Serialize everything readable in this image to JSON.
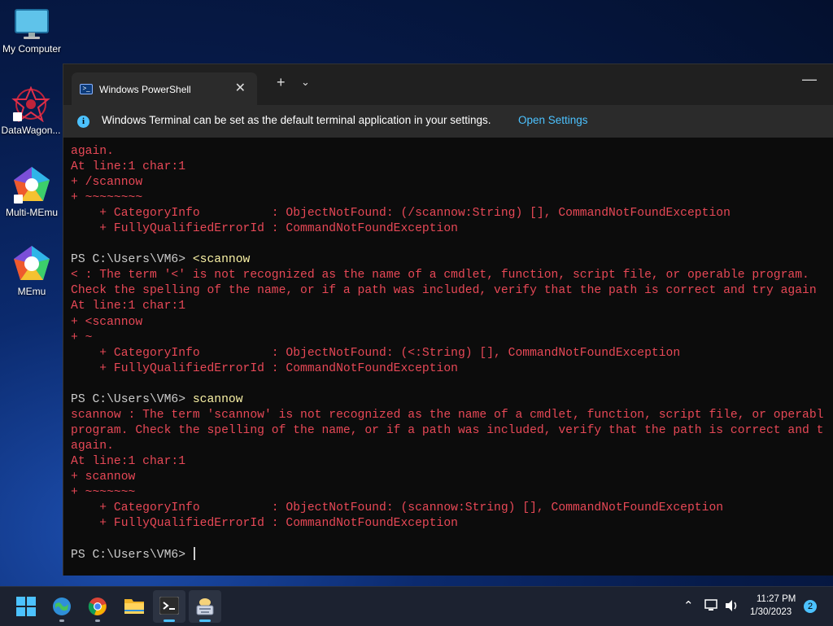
{
  "desktop": {
    "icons": [
      {
        "label": "My Computer"
      },
      {
        "label": "DataWagon..."
      },
      {
        "label": "Multi-MEmu"
      },
      {
        "label": "MEmu"
      }
    ]
  },
  "terminal": {
    "tab_title": "Windows PowerShell",
    "info_text": "Windows Terminal can be set as the default terminal application in your settings.",
    "info_link": "Open Settings",
    "lines": [
      {
        "type": "err",
        "text": "again."
      },
      {
        "type": "err",
        "text": "At line:1 char:1"
      },
      {
        "type": "err",
        "text": "+ /scannow"
      },
      {
        "type": "err",
        "text": "+ ~~~~~~~~"
      },
      {
        "type": "err",
        "text": "    + CategoryInfo          : ObjectNotFound: (/scannow:String) [], CommandNotFoundException"
      },
      {
        "type": "err",
        "text": "    + FullyQualifiedErrorId : CommandNotFoundException"
      },
      {
        "type": "blank",
        "text": ""
      },
      {
        "type": "cmd",
        "prompt": "PS C:\\Users\\VM6> ",
        "text": "<scannow"
      },
      {
        "type": "err",
        "text": "< : The term '<' is not recognized as the name of a cmdlet, function, script file, or operable program."
      },
      {
        "type": "err",
        "text": "Check the spelling of the name, or if a path was included, verify that the path is correct and try again"
      },
      {
        "type": "err",
        "text": "At line:1 char:1"
      },
      {
        "type": "err",
        "text": "+ <scannow"
      },
      {
        "type": "err",
        "text": "+ ~"
      },
      {
        "type": "err",
        "text": "    + CategoryInfo          : ObjectNotFound: (<:String) [], CommandNotFoundException"
      },
      {
        "type": "err",
        "text": "    + FullyQualifiedErrorId : CommandNotFoundException"
      },
      {
        "type": "blank",
        "text": ""
      },
      {
        "type": "cmd",
        "prompt": "PS C:\\Users\\VM6> ",
        "text": "scannow"
      },
      {
        "type": "err",
        "text": "scannow : The term 'scannow' is not recognized as the name of a cmdlet, function, script file, or operabl"
      },
      {
        "type": "err",
        "text": "program. Check the spelling of the name, or if a path was included, verify that the path is correct and t"
      },
      {
        "type": "err",
        "text": "again."
      },
      {
        "type": "err",
        "text": "At line:1 char:1"
      },
      {
        "type": "err",
        "text": "+ scannow"
      },
      {
        "type": "err",
        "text": "+ ~~~~~~~"
      },
      {
        "type": "err",
        "text": "    + CategoryInfo          : ObjectNotFound: (scannow:String) [], CommandNotFoundException"
      },
      {
        "type": "err",
        "text": "    + FullyQualifiedErrorId : CommandNotFoundException"
      },
      {
        "type": "blank",
        "text": ""
      },
      {
        "type": "cmd",
        "prompt": "PS C:\\Users\\VM6> ",
        "text": "",
        "cursor": true
      }
    ]
  },
  "taskbar": {
    "time": "11:27 PM",
    "date": "1/30/2023",
    "notification_count": "2"
  },
  "colors": {
    "error": "#e74856",
    "command": "#f9f1a5",
    "accent": "#4cc2ff"
  }
}
